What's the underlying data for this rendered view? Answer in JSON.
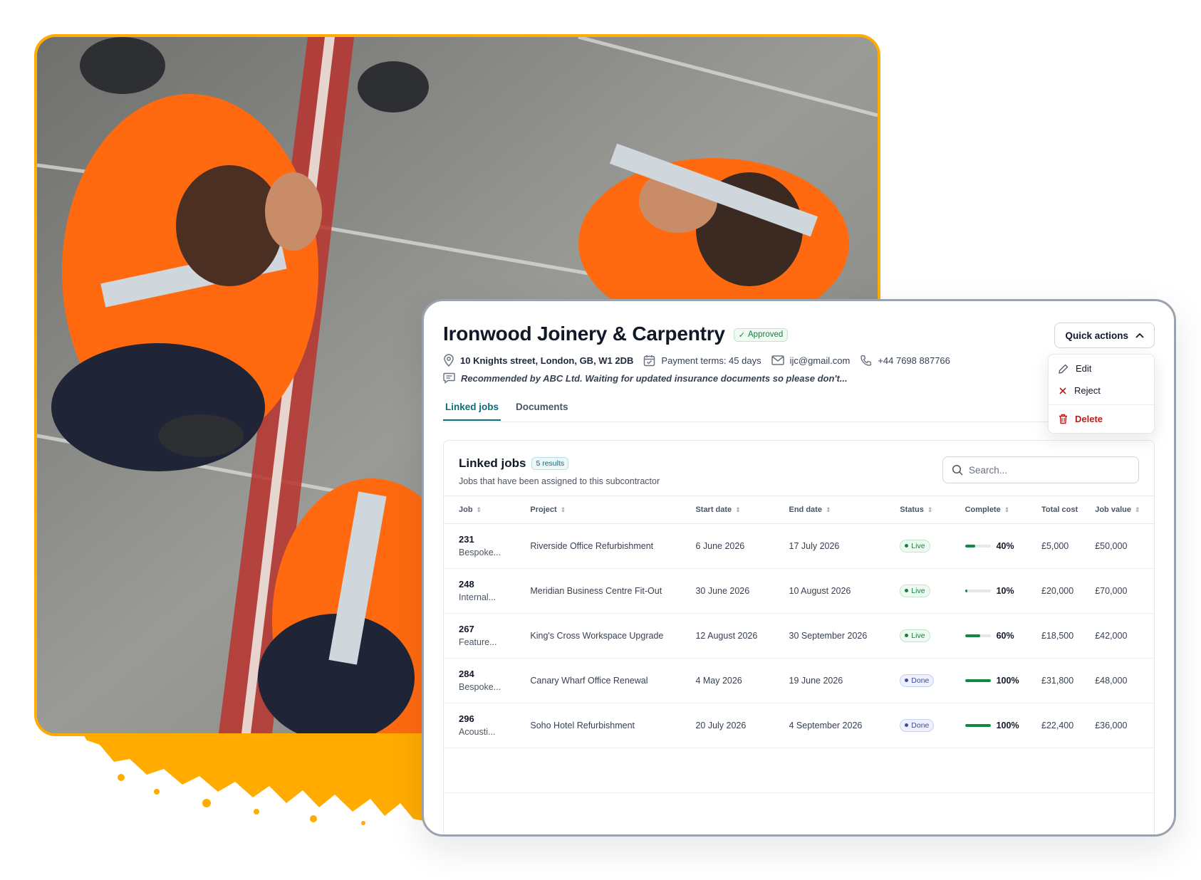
{
  "colors": {
    "accent_orange": "#FFAB00",
    "teal": "#0f6c7a",
    "success": "#15803d",
    "danger": "#b91c1c",
    "progress": "#0f8a43"
  },
  "photo": {
    "subject": "workers in orange hi-vis vests seen from above on concrete"
  },
  "header": {
    "title": "Ironwood Joinery & Carpentry",
    "status_badge": "Approved",
    "address": "10 Knights street, London, GB, W1 2DB",
    "payment_terms": "Payment terms: 45 days",
    "email": "ijc@gmail.com",
    "phone": "+44 7698 887766",
    "note": "Recommended by ABC Ltd. Waiting for updated insurance documents so please don't..."
  },
  "quick_actions": {
    "label": "Quick actions",
    "items": {
      "edit": "Edit",
      "reject": "Reject",
      "delete": "Delete"
    }
  },
  "tabs": {
    "linked_jobs": "Linked jobs",
    "documents": "Documents"
  },
  "card": {
    "title": "Linked jobs",
    "results": "5 results",
    "subtitle": "Jobs that have been assigned to this subcontractor",
    "search_placeholder": "Search..."
  },
  "columns": {
    "job": "Job",
    "project": "Project",
    "start": "Start date",
    "end": "End date",
    "status": "Status",
    "complete": "Complete",
    "total_cost": "Total cost",
    "job_value": "Job value"
  },
  "rows": [
    {
      "num": "231",
      "desc": "Bespoke...",
      "project": "Riverside Office Refurbishment",
      "start": "6 June 2026",
      "end": "17 July 2026",
      "status": "Live",
      "status_type": "live",
      "complete_label": "40%",
      "complete": 0.4,
      "total": "£5,000",
      "value": "£50,000"
    },
    {
      "num": "248",
      "desc": "Internal...",
      "project": "Meridian Business Centre Fit-Out",
      "start": "30 June 2026",
      "end": "10 August 2026",
      "status": "Live",
      "status_type": "live",
      "complete_label": "10%",
      "complete": 0.1,
      "total": "£20,000",
      "value": "£70,000"
    },
    {
      "num": "267",
      "desc": "Feature...",
      "project": "King's Cross Workspace Upgrade",
      "start": "12 August 2026",
      "end": "30 September 2026",
      "status": "Live",
      "status_type": "live",
      "complete_label": "60%",
      "complete": 0.6,
      "total": "£18,500",
      "value": "£42,000"
    },
    {
      "num": "284",
      "desc": "Bespoke...",
      "project": "Canary Wharf Office Renewal",
      "start": "4 May 2026",
      "end": "19 June 2026",
      "status": "Done",
      "status_type": "done",
      "complete_label": "100%",
      "complete": 1.0,
      "total": "£31,800",
      "value": "£48,000"
    },
    {
      "num": "296",
      "desc": "Acousti...",
      "project": "Soho Hotel Refurbishment",
      "start": "20 July 2026",
      "end": "4 September 2026",
      "status": "Done",
      "status_type": "done",
      "complete_label": "100%",
      "complete": 1.0,
      "total": "£22,400",
      "value": "£36,000"
    }
  ]
}
